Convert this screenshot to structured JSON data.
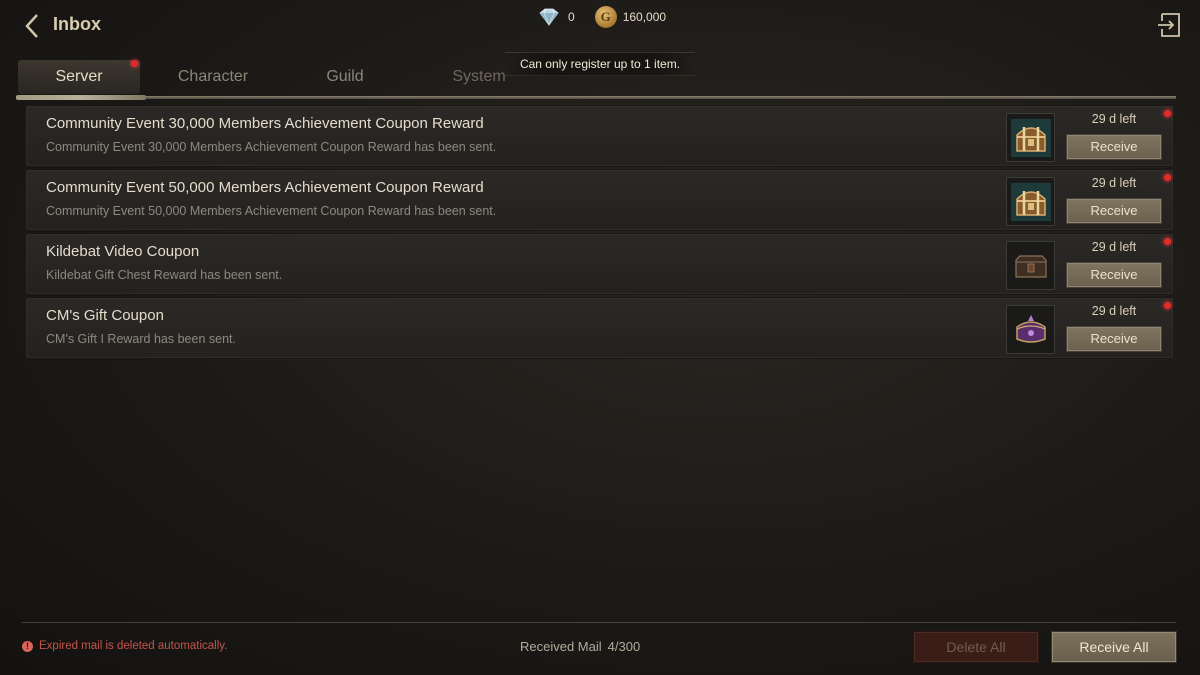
{
  "header": {
    "title": "Inbox",
    "back_icon": "chevron-left-icon",
    "exit_icon": "exit-icon"
  },
  "currency": {
    "gem_icon": "diamond-icon",
    "gems": "0",
    "coin_icon": "gold-coin-icon",
    "coin_letter": "G",
    "gold": "160,000"
  },
  "toast": "Can only register up to 1 item.",
  "tabs": [
    {
      "label": "Server",
      "active": true,
      "notify": true
    },
    {
      "label": "Character",
      "active": false,
      "notify": false
    },
    {
      "label": "Guild",
      "active": false,
      "notify": false
    },
    {
      "label": "System",
      "active": false,
      "notify": false
    }
  ],
  "mails": [
    {
      "title": "Community Event 30,000 Members Achievement Coupon Reward",
      "subtitle": "Community Event 30,000 Members Achievement Coupon Reward has been sent.",
      "item_icon": "treasure-chest-icon",
      "days_left": "29 d left",
      "button": "Receive",
      "unread": true
    },
    {
      "title": "Community Event 50,000 Members Achievement Coupon Reward",
      "subtitle": "Community Event 50,000 Members Achievement Coupon Reward has been sent.",
      "item_icon": "treasure-chest-icon",
      "days_left": "29 d left",
      "button": "Receive",
      "unread": true
    },
    {
      "title": "Kildebat Video Coupon",
      "subtitle": "Kildebat Gift Chest Reward has been sent.",
      "item_icon": "dark-chest-icon",
      "days_left": "29 d left",
      "button": "Receive",
      "unread": true
    },
    {
      "title": "CM's Gift Coupon",
      "subtitle": "CM's Gift I Reward has been sent.",
      "item_icon": "jewel-box-icon",
      "days_left": "29 d left",
      "button": "Receive",
      "unread": true
    }
  ],
  "footer": {
    "warning": "Expired mail is deleted automatically.",
    "warning_icon": "exclamation-icon",
    "counter_label": "Received Mail",
    "counter_value": "4/300",
    "delete_all": "Delete All",
    "receive_all": "Receive All"
  },
  "colors": {
    "accent_gold": "#7c725d",
    "notify_red": "#e12b2b",
    "warning_red": "#c4544a",
    "delete_red": "#3b1d18"
  }
}
